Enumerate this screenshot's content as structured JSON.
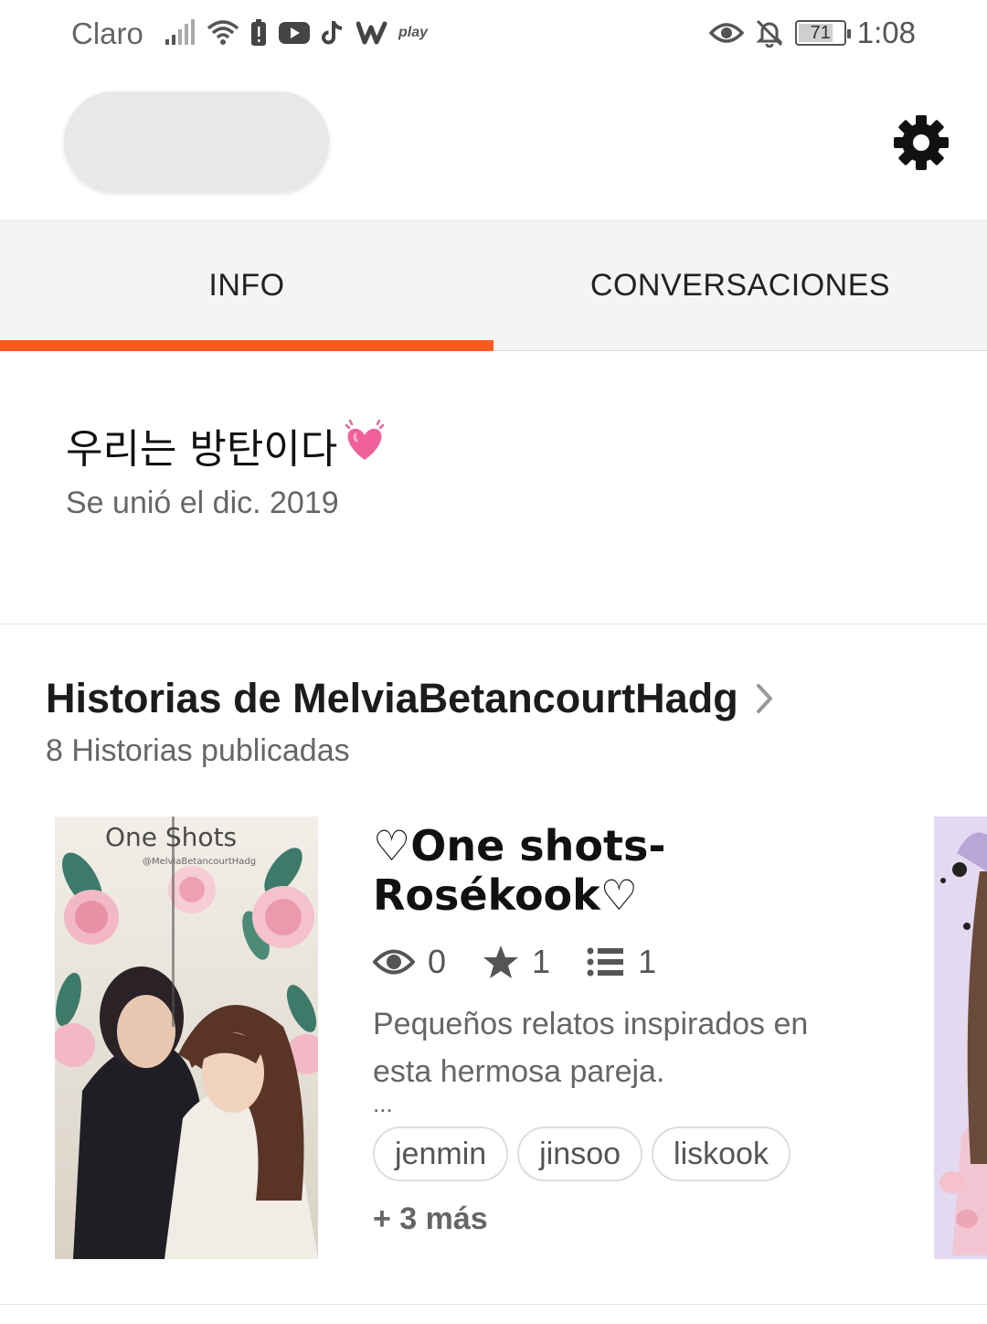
{
  "status_bar": {
    "carrier": "Claro",
    "battery": "71",
    "time": "1:08",
    "left_icons": [
      "signal-icon",
      "wifi-icon",
      "battery-alert-icon",
      "youtube-icon",
      "tiktok-icon",
      "wattpad-icon",
      "play-icon"
    ],
    "right_icons": [
      "eye-icon",
      "bell-off-icon",
      "battery-icon"
    ],
    "play_label": "play"
  },
  "header": {
    "settings_icon": "gear-icon"
  },
  "tabs": [
    {
      "label": "INFO",
      "active": true
    },
    {
      "label": "CONVERSACIONES",
      "active": false
    }
  ],
  "accent_color": "#ff5a1e",
  "profile": {
    "about": "우리는 방탄이다",
    "about_emoji": "heart-icon",
    "joined": "Se unió el dic. 2019"
  },
  "stories": {
    "title": "Historias de MelviaBetancourtHadg",
    "count": "8 Historias publicadas",
    "items": [
      {
        "cover_title": "One Shots",
        "cover_credit": "@MelviaBetancourtHadg",
        "title": "♡One shots-Rosékook♡",
        "reads": "0",
        "votes": "1",
        "parts": "1",
        "description": "Pequeños relatos inspirados en esta hermosa pareja.",
        "ellipsis": "...",
        "tags": [
          "jenmin",
          "jinsoo",
          "liskook"
        ],
        "more_tags": "+ 3 más"
      }
    ]
  }
}
